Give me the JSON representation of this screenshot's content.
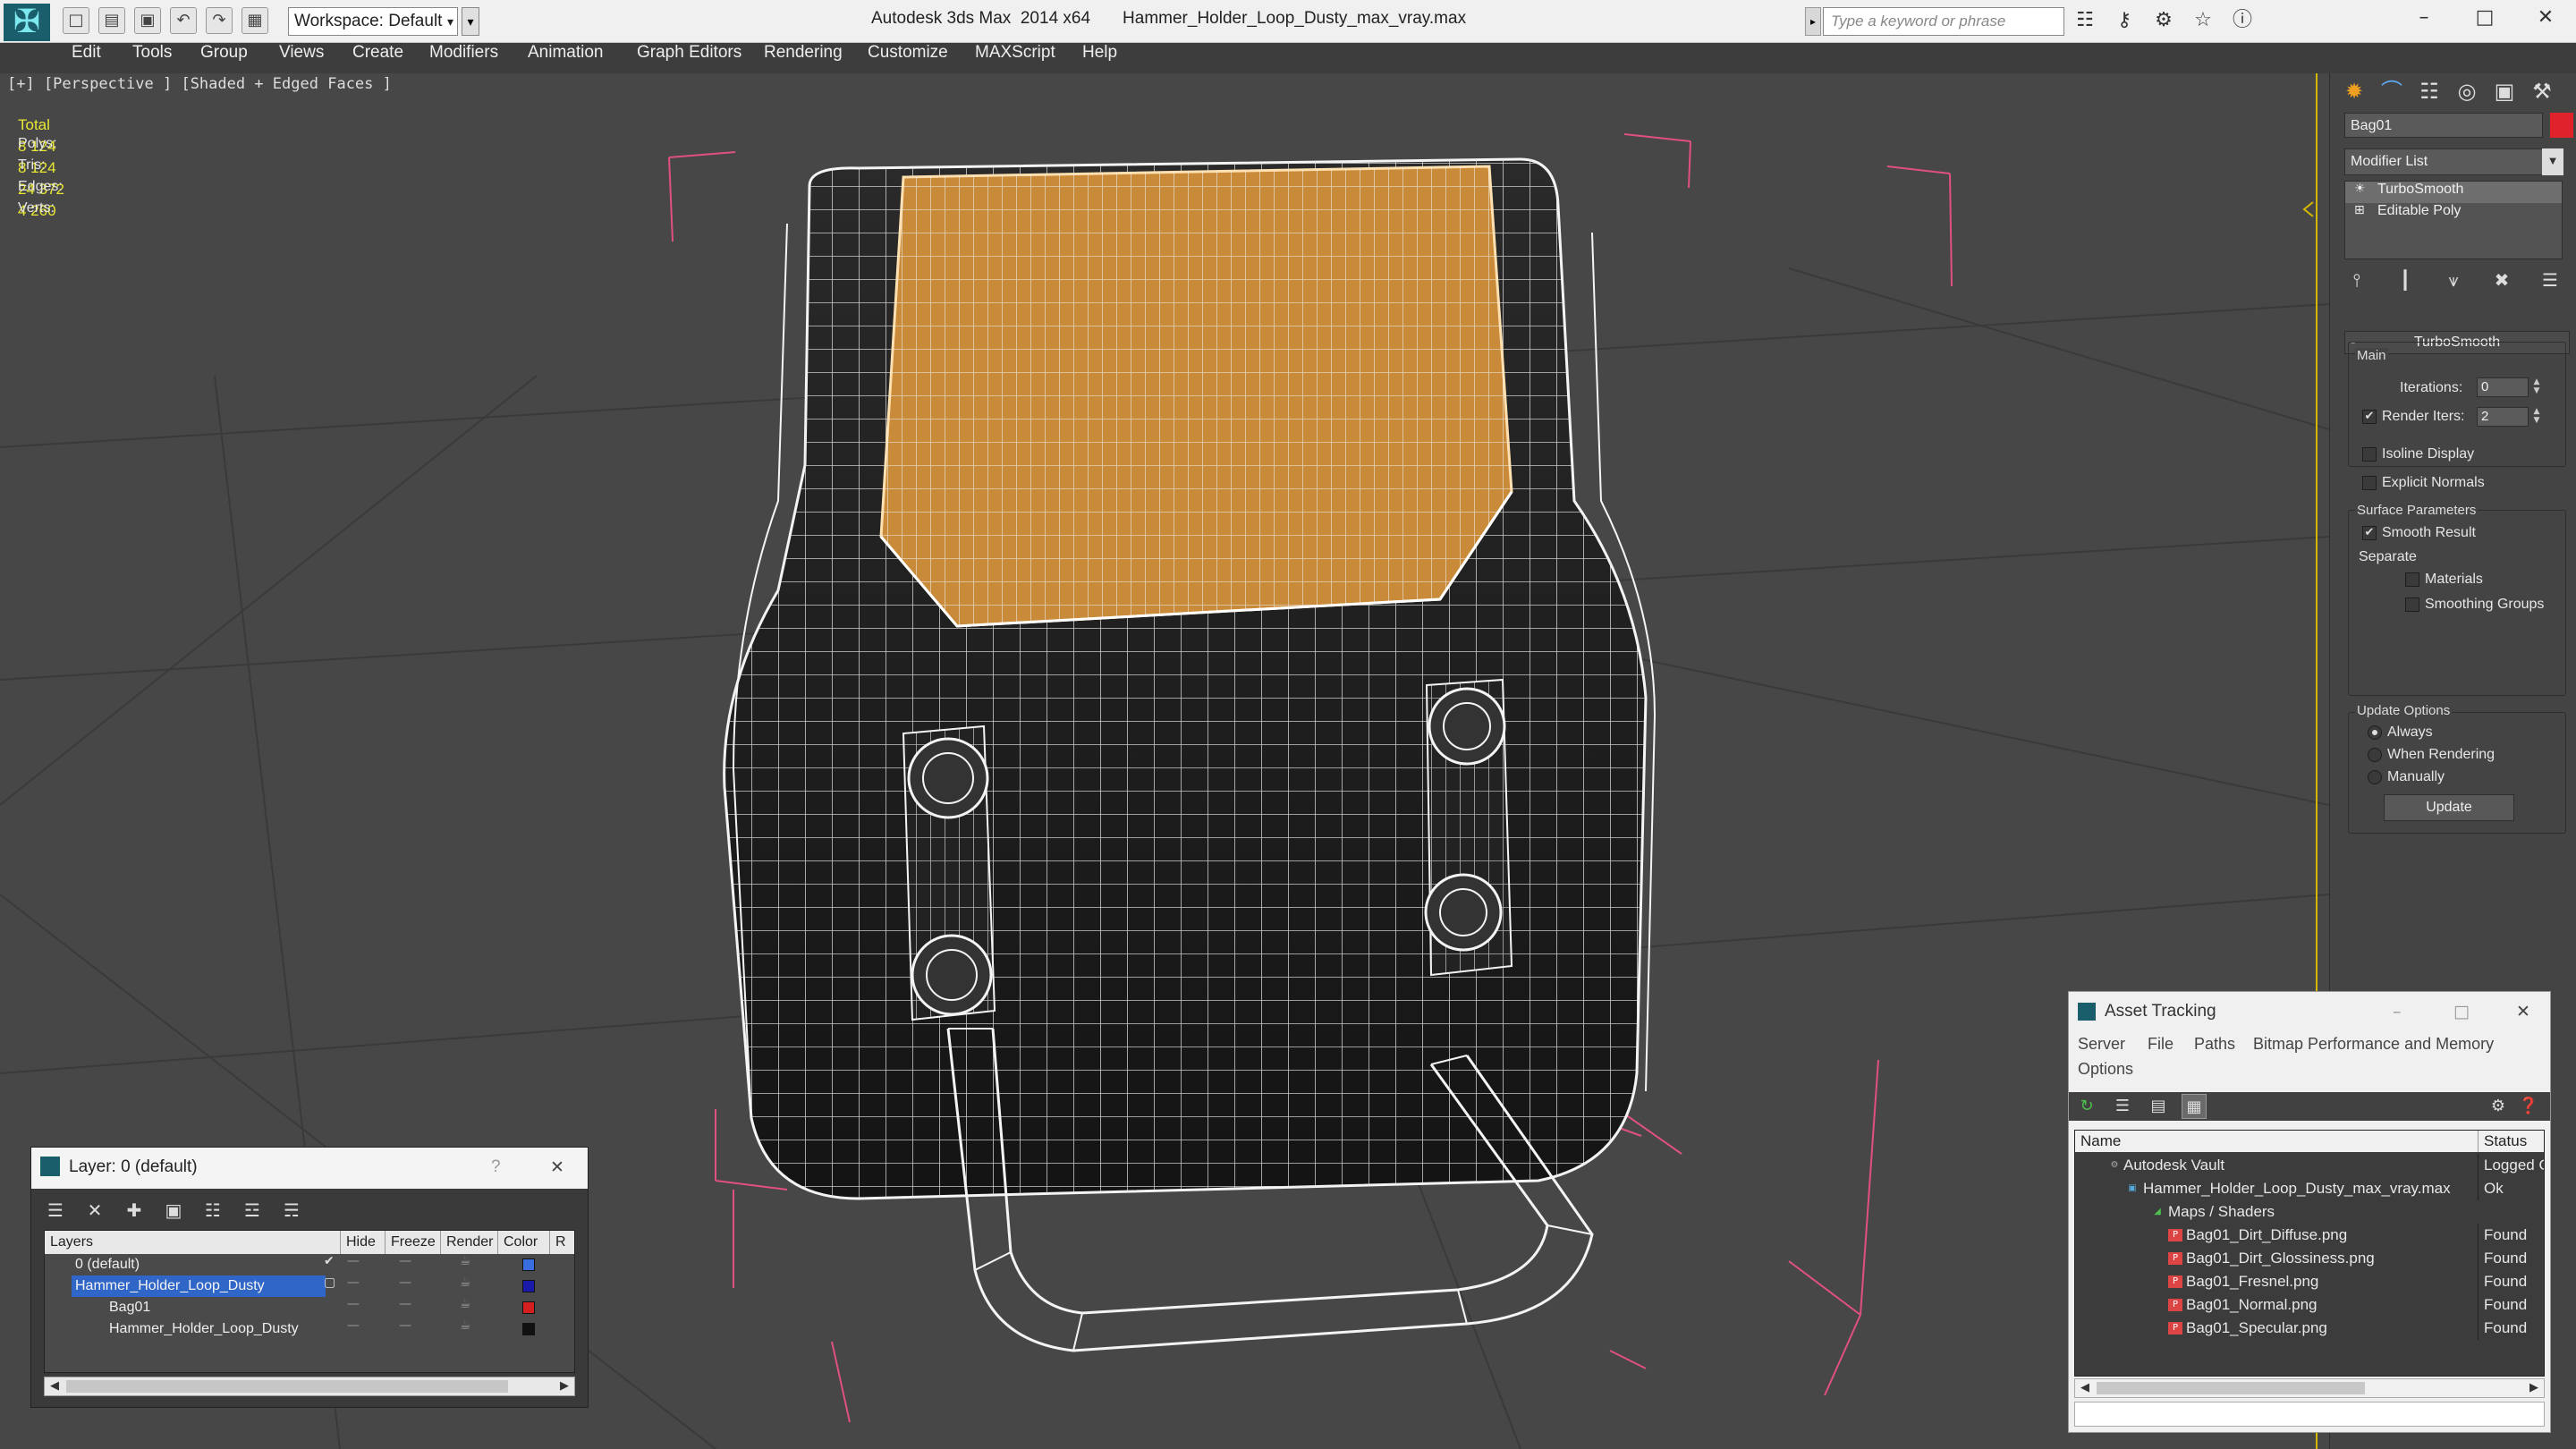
{
  "titlebar": {
    "workspace_label": "Workspace: Default",
    "app_title": "Autodesk 3ds Max  2014 x64",
    "file_title": "Hammer_Holder_Loop_Dusty_max_vray.max",
    "search_placeholder": "Type a keyword or phrase",
    "quick_access": [
      "new-file-icon",
      "open-file-icon",
      "save-icon",
      "undo-icon",
      "redo-icon",
      "project-folder-icon"
    ],
    "toolbar_icons": [
      "binoculars-icon",
      "key-icon",
      "star-icon",
      "help-icon"
    ]
  },
  "menu": {
    "items": [
      "Edit",
      "Tools",
      "Group",
      "Views",
      "Create",
      "Modifiers",
      "Animation",
      "Graph Editors",
      "Rendering",
      "Customize",
      "MAXScript",
      "Help"
    ]
  },
  "viewport": {
    "label": "[+] [Perspective ] [Shaded + Edged Faces ]",
    "stats": {
      "header": "Total",
      "polys_label": "Polys:",
      "polys": "8 124",
      "tris_label": "Tris:",
      "tris": "8 124",
      "edges_label": "Edges:",
      "edges": "24 372",
      "verts_label": "Verts:",
      "verts": "4 260"
    }
  },
  "command_panel": {
    "tabs": [
      "create-icon",
      "modify-icon",
      "hierarchy-icon",
      "motion-icon",
      "display-icon",
      "utilities-icon"
    ],
    "object_name": "Bag01",
    "object_color": "#e0222a",
    "modifier_list": "Modifier List",
    "stack": [
      "TurboSmooth",
      "Editable Poly"
    ],
    "rollout_title": "TurboSmooth",
    "main_group": "Main",
    "iterations_label": "Iterations:",
    "iterations_value": "0",
    "render_iters_label": "Render Iters:",
    "render_iters_value": "2",
    "render_iters_checked": true,
    "isoline_label": "Isoline Display",
    "explicit_normals_label": "Explicit Normals",
    "surface_group": "Surface Parameters",
    "smooth_result_label": "Smooth Result",
    "separate_label": "Separate",
    "materials_label": "Materials",
    "smoothing_groups_label": "Smoothing Groups",
    "update_group": "Update Options",
    "always_label": "Always",
    "when_rendering_label": "When Rendering",
    "manually_label": "Manually",
    "update_button": "Update"
  },
  "layer_window": {
    "title": "Layer: 0 (default)",
    "help": "?",
    "columns": [
      "Layers",
      "Hide",
      "Freeze",
      "Render",
      "Color",
      "R"
    ],
    "rows": [
      {
        "name": "0 (default)",
        "color": "#3a6ee0",
        "current": true
      },
      {
        "name": "Hammer_Holder_Loop_Dusty",
        "color": "#1a1aa8",
        "selected": true
      },
      {
        "name": "Bag01",
        "color": "#d42020"
      },
      {
        "name": "Hammer_Holder_Loop_Dusty",
        "color": "#111111"
      }
    ]
  },
  "asset_tracking": {
    "title": "Asset Tracking",
    "menu": [
      "Server",
      "File",
      "Paths",
      "Bitmap Performance and Memory",
      "Options"
    ],
    "columns": [
      "Name",
      "Status"
    ],
    "rows": [
      {
        "name": "Autodesk Vault",
        "status": "Logged O"
      },
      {
        "name": "Hammer_Holder_Loop_Dusty_max_vray.max",
        "status": "Ok"
      },
      {
        "name": "Maps / Shaders",
        "status": ""
      },
      {
        "name": "Bag01_Dirt_Diffuse.png",
        "status": "Found"
      },
      {
        "name": "Bag01_Dirt_Glossiness.png",
        "status": "Found"
      },
      {
        "name": "Bag01_Fresnel.png",
        "status": "Found"
      },
      {
        "name": "Bag01_Normal.png",
        "status": "Found"
      },
      {
        "name": "Bag01_Specular.png",
        "status": "Found"
      }
    ]
  },
  "colors": {
    "viewport_bg": "#474747",
    "wire": "#ffffff",
    "flap": "#c98a3a",
    "body": "#1e1e1e",
    "stats": "#e8e832",
    "selection": "#2f66c8"
  }
}
